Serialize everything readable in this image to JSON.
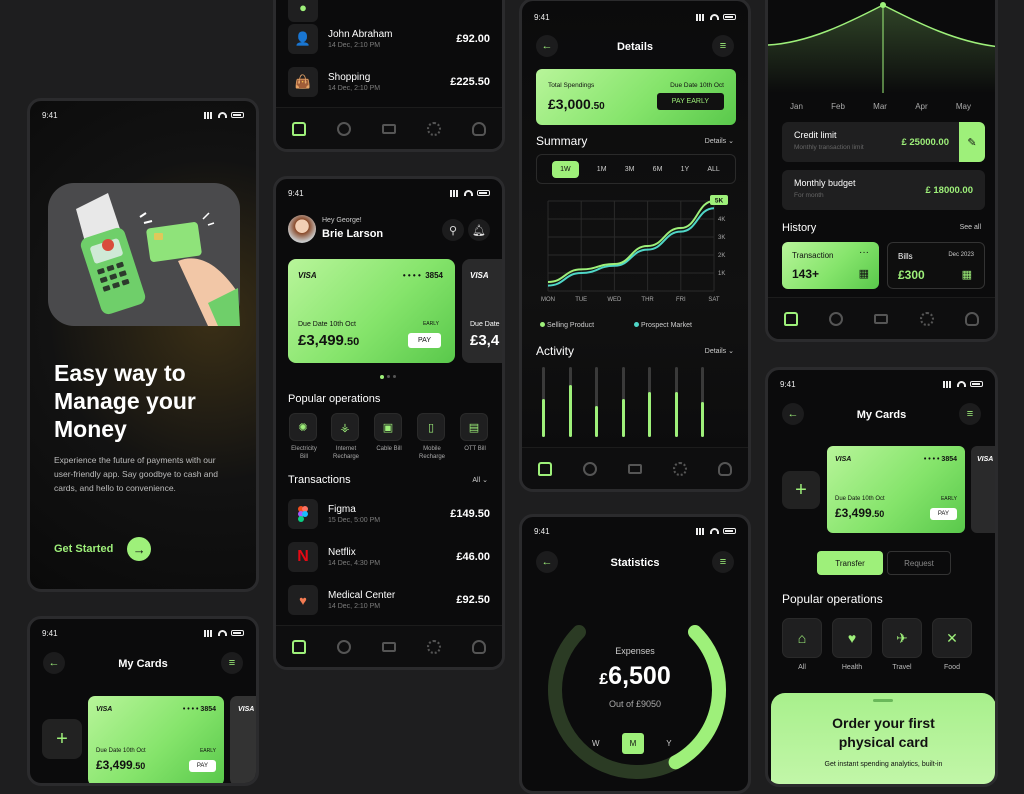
{
  "status_time": "9:41",
  "onboarding": {
    "title_lines": [
      "Easy way to",
      "Manage your",
      "Money"
    ],
    "description": "Experience the future of payments with our user-friendly app. Say goodbye to cash and cards, and hello to convenience.",
    "cta": "Get Started"
  },
  "top_transactions": [
    {
      "name": "John Abraham",
      "date": "14 Dec, 2:10 PM",
      "amount": "£92.00",
      "icon": "person-icon"
    },
    {
      "name": "Shopping",
      "date": "14 Dec, 2:10 PM",
      "amount": "£225.50",
      "icon": "shopping-bag-icon"
    }
  ],
  "home": {
    "greeting": "Hey George!",
    "user": "Brie Larson",
    "card": {
      "brand": "VISA",
      "dots": "• • • •",
      "last4": "3854",
      "due": "Due Date 10th Oct",
      "amount_main": "£3,499",
      "amount_dec": ".50",
      "tag": "EARLY",
      "pay": "PAY"
    },
    "card2": {
      "brand": "VISA",
      "due": "Due Date",
      "amount": "£3,4"
    },
    "ops_title": "Popular operations",
    "ops": [
      {
        "label": "Electricity Bill",
        "icon": "bulb-icon"
      },
      {
        "label": "Internet Recharge",
        "icon": "wifi-tower-icon"
      },
      {
        "label": "Cable Bill",
        "icon": "tv-icon"
      },
      {
        "label": "Mobile Recharge",
        "icon": "mobile-icon"
      },
      {
        "label": "OTT Bill",
        "icon": "ott-icon"
      }
    ],
    "tx_title": "Transactions",
    "tx_filter": "All",
    "transactions": [
      {
        "name": "Figma",
        "date": "15 Dec, 5:00 PM",
        "amount": "£149.50",
        "color": "#f24e1e"
      },
      {
        "name": "Netflix",
        "date": "14 Dec, 4:30 PM",
        "amount": "£46.00",
        "color": "#e50914"
      },
      {
        "name": "Medical Center",
        "date": "14 Dec, 2:10 PM",
        "amount": "£92.50",
        "color": "#f37b52"
      }
    ]
  },
  "details": {
    "title": "Details",
    "spend_label": "Total Spendings",
    "due": "Due Date 10th Oct",
    "amount_main": "£3,000",
    "amount_dec": ".50",
    "pay_early": "PAY EARLY",
    "summary": "Summary",
    "details_link": "Details",
    "ranges": [
      "1W",
      "1M",
      "3M",
      "6M",
      "1Y",
      "ALL"
    ],
    "active_range": "1W",
    "legend": [
      "Selling Product",
      "Prospect Market"
    ],
    "activity": "Activity",
    "activity_link": "Details",
    "activity_levels": [
      0.55,
      0.75,
      0.45,
      0.55,
      0.65,
      0.65,
      0.5
    ]
  },
  "chart_data": {
    "type": "line",
    "categories": [
      "MON",
      "TUE",
      "WED",
      "THR",
      "FRI",
      "SAT"
    ],
    "y_ticks": [
      "5K",
      "4K",
      "3K",
      "2K",
      "1K"
    ],
    "ylim": [
      0,
      5000
    ],
    "badge": "5K",
    "series": [
      {
        "name": "Selling Product",
        "color": "#9ef07a",
        "values": [
          500,
          1200,
          1500,
          2500,
          3500,
          5000
        ]
      },
      {
        "name": "Prospect Market",
        "color": "#4fd6c7",
        "values": [
          300,
          1000,
          1400,
          2300,
          3300,
          4600
        ]
      }
    ]
  },
  "stats": {
    "title": "Statistics",
    "label": "Expenses",
    "currency": "£",
    "amount": "6,500",
    "sub": "Out of £9050",
    "progress": 0.72,
    "periods": [
      "W",
      "M",
      "Y"
    ],
    "active_period": "M"
  },
  "right_top": {
    "months": [
      "Jan",
      "Feb",
      "Mar",
      "Apr",
      "May"
    ],
    "credit_title": "Credit limit",
    "credit_sub": "Monthly transaction limit",
    "credit_amt": "£ 25000.00",
    "budget_title": "Monthly budget",
    "budget_sub": "For month",
    "budget_amt": "£ 18000.00",
    "history": "History",
    "see_all": "See all",
    "tx_label": "Transaction",
    "tx_count": "143+",
    "bills_label": "Bills",
    "bills_date": "Dec 2023",
    "bills_amt": "£300"
  },
  "mycards": {
    "title": "My Cards",
    "transfer": "Transfer",
    "request": "Request",
    "ops_title": "Popular operations",
    "ops": [
      {
        "label": "All",
        "icon": "home-icon"
      },
      {
        "label": "Health",
        "icon": "heart-icon"
      },
      {
        "label": "Travel",
        "icon": "plane-icon"
      },
      {
        "label": "Food",
        "icon": "fork-knife-icon"
      }
    ],
    "order_title_1": "Order your first",
    "order_title_2": "physical card",
    "order_sub": "Get instant spending analytics, built-in"
  }
}
